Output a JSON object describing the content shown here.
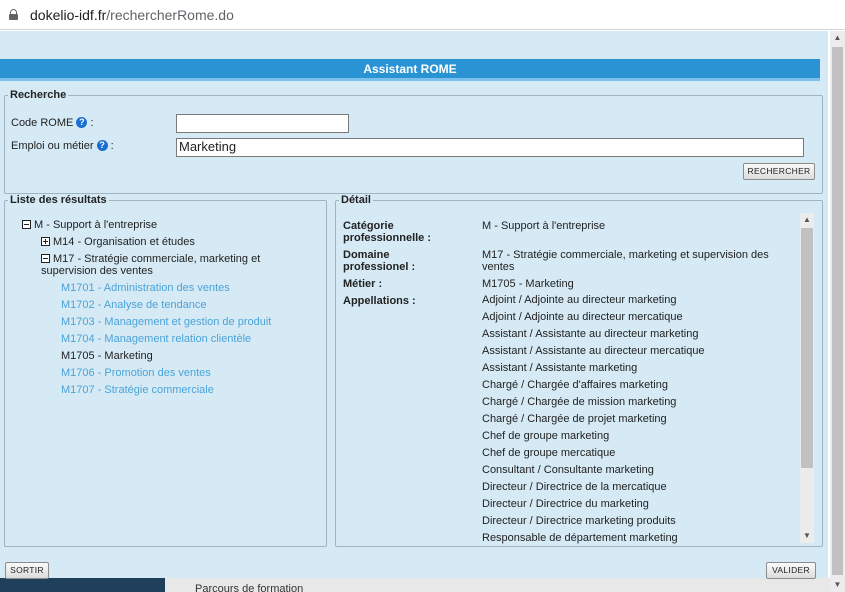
{
  "browser": {
    "url_domain": "dokelio-idf.fr",
    "url_path": "/rechercherRome.do"
  },
  "background": {
    "partial_text": "Parcours de formation"
  },
  "dialog": {
    "title": "Assistant ROME",
    "search": {
      "legend": "Recherche",
      "code_label": "Code ROME",
      "code_value": "",
      "emploi_label": "Emploi ou métier",
      "emploi_value": "Marketing",
      "help_glyph": "?",
      "colon": ":",
      "search_button": "RECHERCHER"
    },
    "results": {
      "legend": "Liste des résultats",
      "root": "M - Support à l'entreprise",
      "m14": "M14 - Organisation et études",
      "m17_line1": "M17 - Stratégie commerciale, marketing et",
      "m17_line2": "supervision des ventes",
      "leaves": [
        {
          "label": "M1701 - Administration des ventes",
          "selected": false
        },
        {
          "label": "M1702 - Analyse de tendance",
          "selected": false
        },
        {
          "label": "M1703 - Management et gestion de produit",
          "selected": false
        },
        {
          "label": "M1704 - Management relation clientèle",
          "selected": false
        },
        {
          "label": "M1705 - Marketing",
          "selected": true
        },
        {
          "label": "M1706 - Promotion des ventes",
          "selected": false
        },
        {
          "label": "M1707 - Stratégie commerciale",
          "selected": false
        }
      ]
    },
    "detail": {
      "legend": "Détail",
      "categorie_label_1": "Catégorie",
      "categorie_label_2": "professionnelle :",
      "categorie_value": "M - Support à l'entreprise",
      "domaine_label_1": "Domaine",
      "domaine_label_2": "professionel :",
      "domaine_value_1": "M17 - Stratégie commerciale, marketing et supervision des",
      "domaine_value_2": "ventes",
      "metier_label": "Métier :",
      "metier_value": "M1705 - Marketing",
      "appellations_label": "Appellations :",
      "appellations": [
        "Adjoint / Adjointe au directeur marketing",
        "Adjoint / Adjointe au directeur mercatique",
        "Assistant / Assistante au directeur marketing",
        "Assistant / Assistante au directeur mercatique",
        "Assistant / Assistante marketing",
        "Chargé / Chargée d'affaires marketing",
        "Chargé / Chargée de mission marketing",
        "Chargé / Chargée de projet marketing",
        "Chef de groupe marketing",
        "Chef de groupe mercatique",
        "Consultant / Consultante marketing",
        "Directeur / Directrice de la mercatique",
        "Directeur / Directrice du marketing",
        "Directeur / Directrice marketing produits",
        "Responsable de département marketing"
      ]
    },
    "footer": {
      "sortir": "SORTIR",
      "valider": "VALIDER"
    }
  }
}
